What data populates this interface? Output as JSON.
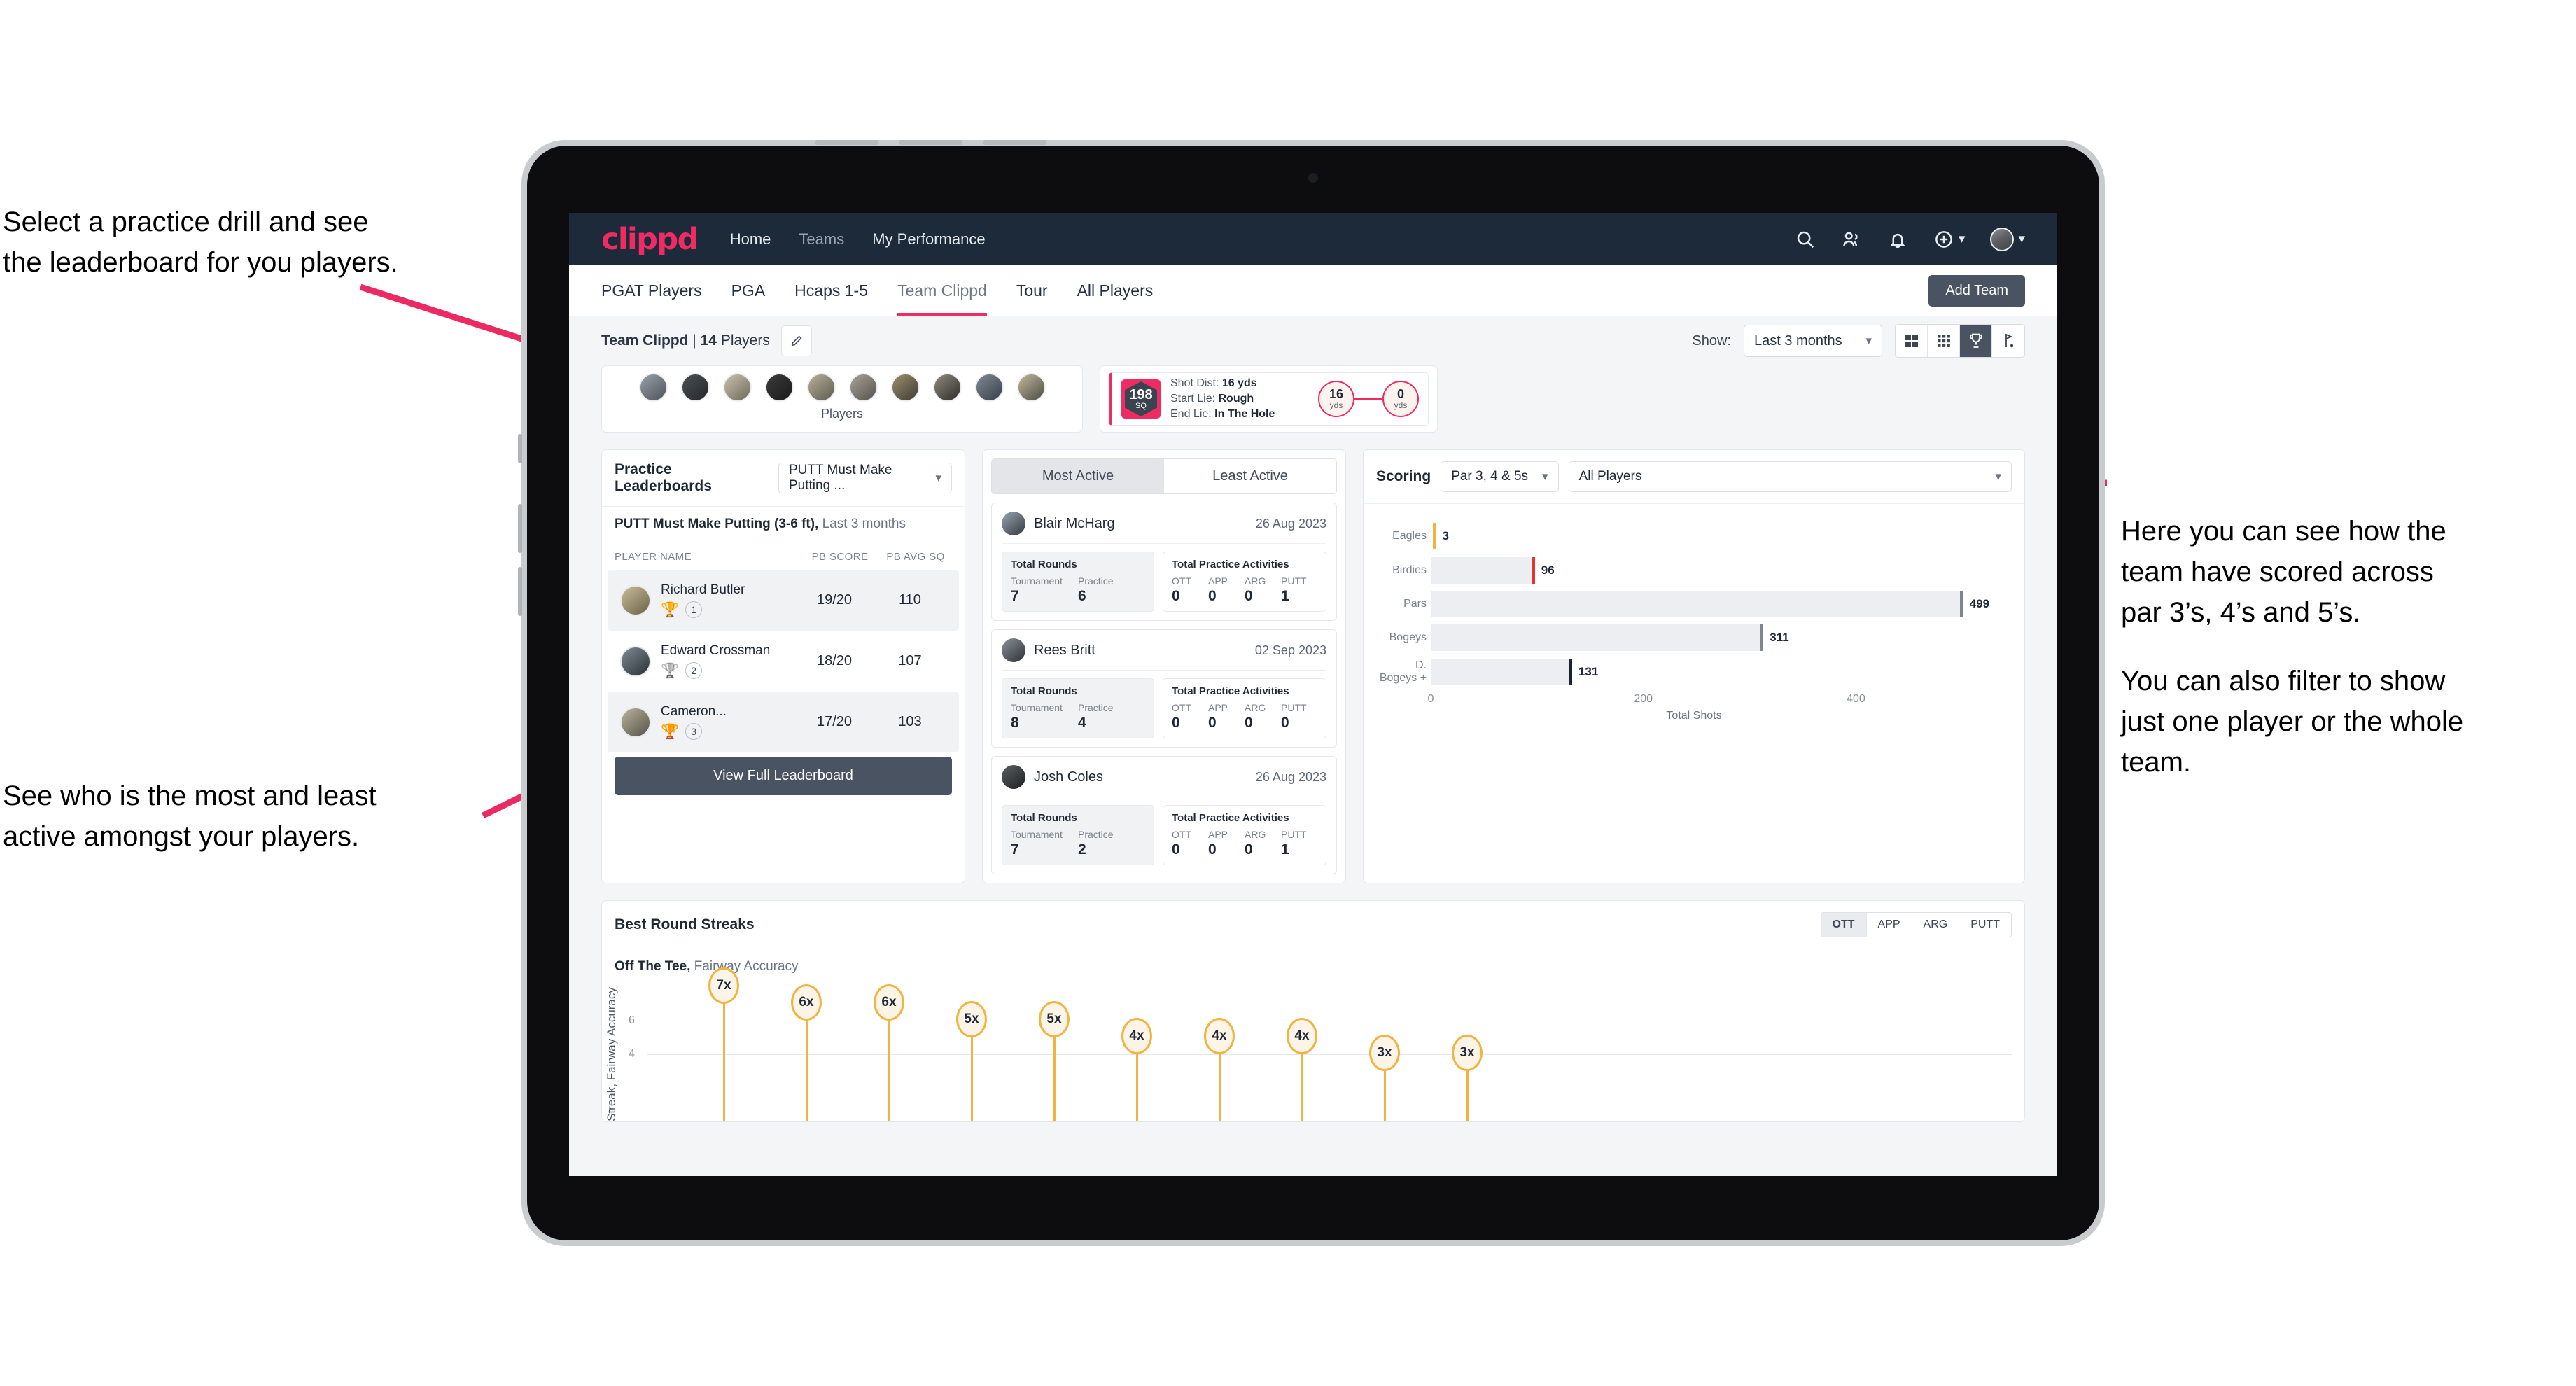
{
  "annotations": {
    "top_left": [
      "Select a practice drill and see",
      "the leaderboard for you players."
    ],
    "bottom_left": [
      "See who is the most and least",
      "active amongst your players."
    ],
    "right_1": [
      "Here you can see how the",
      "team have scored across",
      "par 3’s, 4’s and 5’s."
    ],
    "right_2": [
      "You can also filter to show",
      "just one player or the whole",
      "team."
    ]
  },
  "app": {
    "logo": "clippd",
    "nav": [
      {
        "label": "Home",
        "active": true
      },
      {
        "label": "Teams",
        "active": false
      },
      {
        "label": "My Performance",
        "active": true
      }
    ],
    "nav_icons": [
      "search-icon",
      "people-icon",
      "bell-icon",
      "plus-circle-icon",
      "avatar"
    ],
    "tabs": [
      {
        "label": "PGAT Players",
        "active": false
      },
      {
        "label": "PGA",
        "active": false
      },
      {
        "label": "Hcaps 1-5",
        "active": false
      },
      {
        "label": "Team Clippd",
        "active": true
      },
      {
        "label": "Tour",
        "active": false
      },
      {
        "label": "All Players",
        "active": false
      }
    ],
    "add_team_label": "Add Team",
    "toolbar": {
      "team_name": "Team Clippd",
      "separator": "|",
      "player_count": "14",
      "players_word": "Players",
      "show_label": "Show:",
      "show_value": "Last 3 months",
      "view_buttons": [
        "grid-large-icon",
        "grid-small-icon",
        "trophy-icon",
        "flag-icon"
      ],
      "active_view": "trophy-icon"
    }
  },
  "players_strip": {
    "label": "Players",
    "count": 10
  },
  "shot_card": {
    "sq_value": "198",
    "sq_label": "SQ",
    "shot_dist_key": "Shot Dist:",
    "shot_dist_val": "16 yds",
    "start_lie_key": "Start Lie:",
    "start_lie_val": "Rough",
    "end_lie_key": "End Lie:",
    "end_lie_val": "In The Hole",
    "from_value": "16",
    "from_unit": "yds",
    "to_value": "0",
    "to_unit": "yds"
  },
  "leaderboard": {
    "title": "Practice Leaderboards",
    "drill_select": "PUTT Must Make Putting ...",
    "subtitle_bold": "PUTT Must Make Putting (3-6 ft),",
    "subtitle_rest": "Last 3 months",
    "columns": [
      "PLAYER NAME",
      "PB SCORE",
      "PB AVG SQ"
    ],
    "rows": [
      {
        "name": "Richard Butler",
        "rank": "1",
        "trophy": "gold",
        "score": "19/20",
        "avg": "110",
        "highlight": true
      },
      {
        "name": "Edward Crossman",
        "rank": "2",
        "trophy": "silver",
        "score": "18/20",
        "avg": "107",
        "highlight": false
      },
      {
        "name": "Cameron...",
        "rank": "3",
        "trophy": "bronze",
        "score": "17/20",
        "avg": "103",
        "highlight": true
      }
    ],
    "button_label": "View Full Leaderboard"
  },
  "activity": {
    "tabs": [
      {
        "label": "Most Active",
        "active": true
      },
      {
        "label": "Least Active",
        "active": false
      }
    ],
    "rounds_header": "Total Rounds",
    "rounds_keys": [
      "Tournament",
      "Practice"
    ],
    "practice_header": "Total Practice Activities",
    "practice_keys": [
      "OTT",
      "APP",
      "ARG",
      "PUTT"
    ],
    "items": [
      {
        "name": "Blair McHarg",
        "date": "26 Aug 2023",
        "tournament": "7",
        "practice": "6",
        "ott": "0",
        "app": "0",
        "arg": "0",
        "putt": "1"
      },
      {
        "name": "Rees Britt",
        "date": "02 Sep 2023",
        "tournament": "8",
        "practice": "4",
        "ott": "0",
        "app": "0",
        "arg": "0",
        "putt": "0"
      },
      {
        "name": "Josh Coles",
        "date": "26 Aug 2023",
        "tournament": "7",
        "practice": "2",
        "ott": "0",
        "app": "0",
        "arg": "0",
        "putt": "1"
      }
    ]
  },
  "scoring": {
    "title": "Scoring",
    "par_select": "Par 3, 4 & 5s",
    "player_select": "All Players"
  },
  "streaks": {
    "title": "Best Round Streaks",
    "seg": [
      {
        "label": "OTT",
        "active": true
      },
      {
        "label": "APP",
        "active": false
      },
      {
        "label": "ARG",
        "active": false
      },
      {
        "label": "PUTT",
        "active": false
      }
    ],
    "sub_bold": "Off The Tee,",
    "sub_rest": "Fairway Accuracy"
  },
  "chart_data": [
    {
      "type": "bar",
      "orientation": "horizontal",
      "title": "Scoring",
      "categories": [
        "Eagles",
        "Birdies",
        "Pars",
        "Bogeys",
        "D. Bogeys +"
      ],
      "values": [
        3,
        96,
        499,
        311,
        131
      ],
      "cap_colors": [
        "#f0b440",
        "#e8332f",
        "#7f868f",
        "#7f868f",
        "#1d232c"
      ],
      "xlabel": "Total Shots",
      "ylabel": "",
      "xticks": [
        0,
        200,
        400
      ],
      "xlim": [
        0,
        540
      ],
      "grid": true,
      "legend": "none"
    },
    {
      "type": "bar",
      "orientation": "vertical-lollipop",
      "title": "Best Round Streaks",
      "subtitle": "Off The Tee, Fairway Accuracy",
      "categories": [
        "1",
        "2",
        "3",
        "4",
        "5",
        "6",
        "7",
        "8",
        "9",
        "10"
      ],
      "labels": [
        "7x",
        "6x",
        "6x",
        "5x",
        "5x",
        "4x",
        "4x",
        "4x",
        "3x",
        "3x"
      ],
      "values": [
        7,
        6,
        6,
        5,
        5,
        4,
        4,
        4,
        3,
        3
      ],
      "ylabel": "Streak, Fairway Accuracy",
      "yticks": [
        4,
        6
      ],
      "ylim": [
        0,
        8
      ],
      "grid": true,
      "legend": "none"
    }
  ]
}
